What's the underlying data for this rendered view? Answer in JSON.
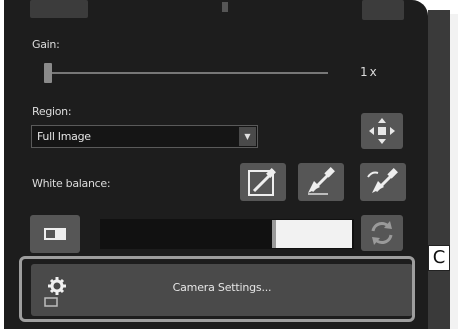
{
  "panel": {
    "gain": {
      "label": "Gain:",
      "value_text": "1x",
      "slider_fraction": 0.0
    },
    "region": {
      "label": "Region:",
      "selected": "Full Image",
      "dropdown_arrow": "▼"
    },
    "white_balance": {
      "label": "White balance:",
      "buttons": [
        {
          "icon": "eyedropper-area-icon"
        },
        {
          "icon": "eyedropper-icon"
        },
        {
          "icon": "eyedropper-reset-icon"
        }
      ]
    },
    "camera_settings": {
      "label": "Camera Settings...",
      "icon": "gear-icon"
    }
  },
  "callout": {
    "label": "C"
  },
  "colors": {
    "panel_bg": "#1d1d1d",
    "button_bg": "#565656",
    "text": "#dcdcdc",
    "highlight_outline": "#9e9e9e"
  }
}
